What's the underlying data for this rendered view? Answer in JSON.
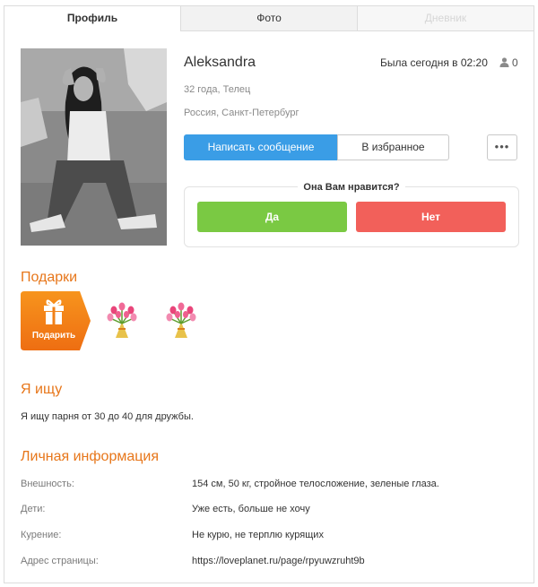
{
  "tabs": [
    {
      "label": "Профиль",
      "active": true
    },
    {
      "label": "Фото",
      "active": false
    },
    {
      "label": "Дневник",
      "active": false
    }
  ],
  "profile": {
    "name": "Aleksandra",
    "last_seen": "Была сегодня в 02:20",
    "views_count": "0",
    "age_sign": "32 года, Телец",
    "location": "Россия, Санкт-Петербург"
  },
  "actions": {
    "message_label": "Написать сообщение",
    "favorite_label": "В избранное",
    "more_label": "•••"
  },
  "like": {
    "question": "Она Вам нравится?",
    "yes_label": "Да",
    "no_label": "Нет"
  },
  "gifts": {
    "title": "Подарки",
    "give_label": "Подарить",
    "items": [
      "bouquet-icon",
      "bouquet-icon"
    ]
  },
  "seeking": {
    "title": "Я ищу",
    "text": "Я ищу парня от 30 до 40 для дружбы."
  },
  "personal": {
    "title": "Личная информация",
    "rows": [
      {
        "label": "Внешность:",
        "value": "154 см, 50 кг, стройное телосложение, зеленые глаза."
      },
      {
        "label": "Дети:",
        "value": "Уже есть, больше не хочу"
      },
      {
        "label": "Курение:",
        "value": "Не курю, не терплю курящих"
      },
      {
        "label": "Адрес страницы:",
        "value": "https://loveplanet.ru/page/rpyuwzruht9b"
      }
    ]
  },
  "colors": {
    "accent_orange": "#e7761a",
    "message_blue": "#3a9de6",
    "yes_green": "#7ac943",
    "no_red": "#f2605a"
  }
}
